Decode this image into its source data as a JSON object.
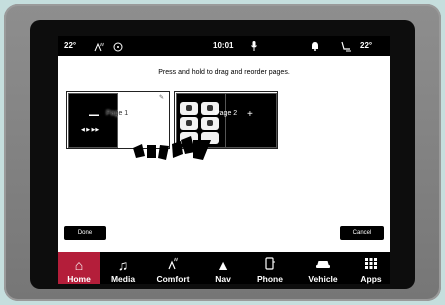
{
  "status": {
    "temp_left": "22°",
    "time": "10:01",
    "temp_right": "22°"
  },
  "instruction": "Press and hold to drag and reorder pages.",
  "pages": {
    "page1_label": "Page 1",
    "page2_label": "Page 2"
  },
  "buttons": {
    "done": "Done",
    "cancel": "Cancel"
  },
  "nav": {
    "items": [
      {
        "label": "Home",
        "icon": "home-icon"
      },
      {
        "label": "Media",
        "icon": "music-note-icon"
      },
      {
        "label": "Comfort",
        "icon": "seat-heater-icon"
      },
      {
        "label": "Nav",
        "icon": "navigation-arrow-icon"
      },
      {
        "label": "Phone",
        "icon": "phone-icon"
      },
      {
        "label": "Vehicle",
        "icon": "car-icon"
      },
      {
        "label": "Apps",
        "icon": "apps-grid-icon"
      }
    ],
    "active": "Home",
    "active_color": "#b41e3a"
  }
}
